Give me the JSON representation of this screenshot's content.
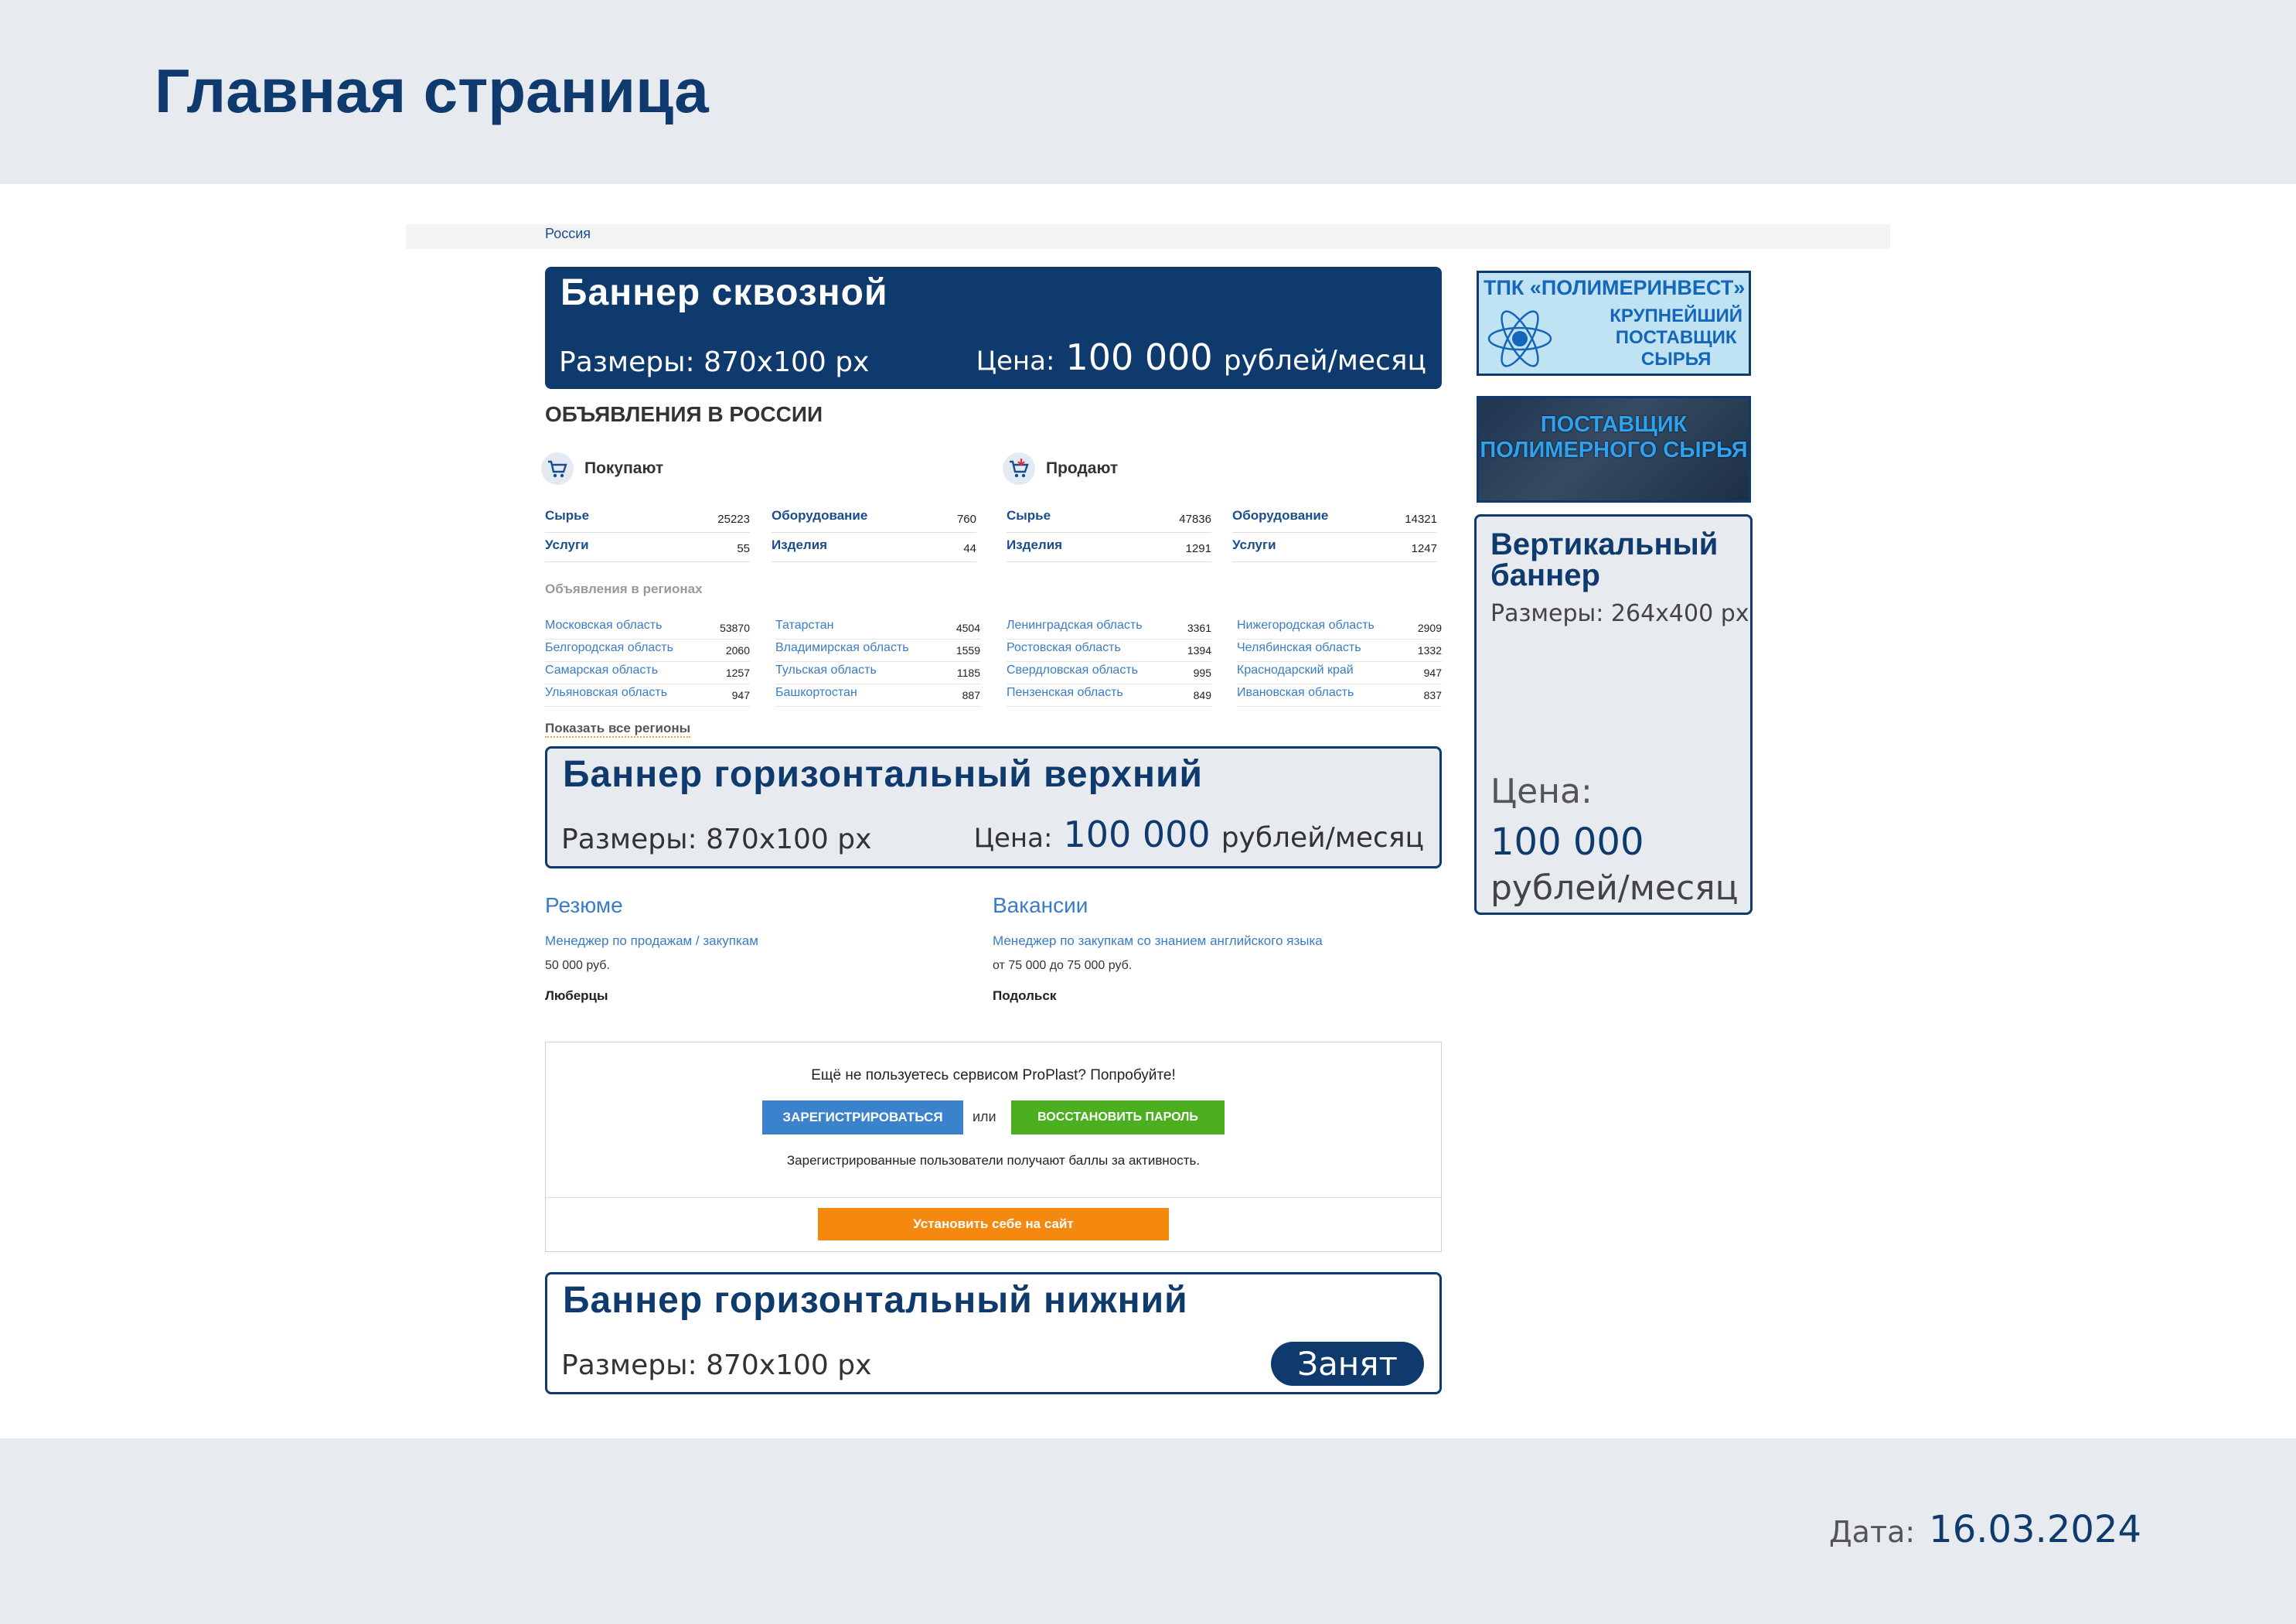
{
  "page": {
    "title": "Главная страница",
    "date_label": "Дата:",
    "date_value": "16.03.2024"
  },
  "breadcrumb": "Россия",
  "banners": {
    "top": {
      "title": "Баннер сквозной",
      "size": "Размеры: 870х100 px",
      "price_label": "Цена:",
      "price_value": "100 000",
      "price_unit": "рублей/месяц"
    },
    "middle": {
      "title": "Баннер горизонтальный верхний",
      "size": "Размеры: 870х100 px",
      "price_label": "Цена:",
      "price_value": "100 000",
      "price_unit": "рублей/месяц"
    },
    "bottom": {
      "title": "Баннер горизонтальный нижний",
      "size": "Размеры: 870х100 px",
      "status": "Занят"
    },
    "vertical": {
      "title_1": "Вертикальный",
      "title_2": "баннер",
      "size": "Размеры: 264х400 px",
      "price_label": "Цена:",
      "price_value": "100 000",
      "price_unit": "рублей/месяц"
    }
  },
  "ads": {
    "heading": "ОБЪЯВЛЕНИЯ В РОССИИ",
    "buy": {
      "label": "Покупают",
      "items": [
        {
          "name": "Сырье",
          "count": "25223"
        },
        {
          "name": "Оборудование",
          "count": "760"
        },
        {
          "name": "Услуги",
          "count": "55"
        },
        {
          "name": "Изделия",
          "count": "44"
        }
      ]
    },
    "sell": {
      "label": "Продают",
      "items": [
        {
          "name": "Сырье",
          "count": "47836"
        },
        {
          "name": "Оборудование",
          "count": "14321"
        },
        {
          "name": "Изделия",
          "count": "1291"
        },
        {
          "name": "Услуги",
          "count": "1247"
        }
      ]
    },
    "regions_heading": "Объявления в регионах",
    "regions": [
      {
        "name": "Московская область",
        "count": "53870"
      },
      {
        "name": "Белгородская область",
        "count": "2060"
      },
      {
        "name": "Самарская область",
        "count": "1257"
      },
      {
        "name": "Ульяновская область",
        "count": "947"
      },
      {
        "name": "Татарстан",
        "count": "4504"
      },
      {
        "name": "Владимирская область",
        "count": "1559"
      },
      {
        "name": "Тульская область",
        "count": "1185"
      },
      {
        "name": "Башкортостан",
        "count": "887"
      },
      {
        "name": "Ленинградская область",
        "count": "3361"
      },
      {
        "name": "Ростовская область",
        "count": "1394"
      },
      {
        "name": "Свердловская область",
        "count": "995"
      },
      {
        "name": "Пензенская область",
        "count": "849"
      },
      {
        "name": "Нижегородская область",
        "count": "2909"
      },
      {
        "name": "Челябинская область",
        "count": "1332"
      },
      {
        "name": "Краснодарский край",
        "count": "947"
      },
      {
        "name": "Ивановская область",
        "count": "837"
      }
    ],
    "show_all": "Показать все регионы"
  },
  "resume": {
    "title": "Резюме",
    "link": "Менеджер по продажам / закупкам",
    "salary": "50 000 руб.",
    "city": "Люберцы"
  },
  "vacancy": {
    "title": "Вакансии",
    "link": "Менеджер по закупкам со знанием английского языка",
    "salary": "от 75 000 до 75 000 руб.",
    "city": "Подольск"
  },
  "register": {
    "prompt": "Ещё не пользуетесь сервисом ProPlast? Попробуйте!",
    "register_label": "ЗАРЕГИСТРИРОВАТЬСЯ",
    "or": "или",
    "restore_label": "ВОССТАНОВИТЬ ПАРОЛЬ",
    "note": "Зарегистрированные пользователи получают баллы за активность.",
    "install_label": "Установить себе на сайт"
  },
  "side_ads": {
    "ad1_line1": "ТПК «ПОЛИМЕРИНВЕСТ»",
    "ad1_line2a": "КРУПНЕЙШИЙ",
    "ad1_line2b": "ПОСТАВЩИК",
    "ad1_line2c": "СЫРЬЯ",
    "ad2_line1": "ПОСТАВЩИК",
    "ad2_line2": "ПОЛИМЕРНОГО СЫРЬЯ"
  },
  "colors": {
    "brand": "#0f3a6e",
    "band": "#e7ebf0",
    "link": "#3a7cc5",
    "green": "#4caf1f",
    "orange": "#f5890f"
  }
}
